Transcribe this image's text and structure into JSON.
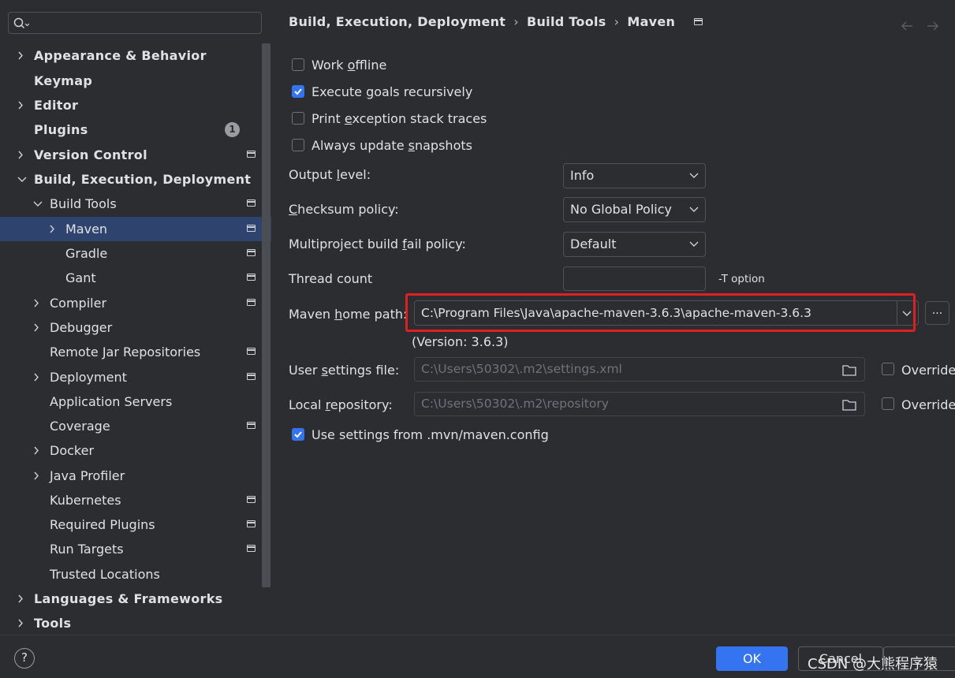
{
  "sidebar": {
    "search_placeholder": "",
    "items": [
      {
        "label": "Appearance & Behavior"
      },
      {
        "label": "Keymap"
      },
      {
        "label": "Editor"
      },
      {
        "label": "Plugins",
        "badge": "1"
      },
      {
        "label": "Version Control"
      },
      {
        "label": "Build, Execution, Deployment"
      },
      {
        "label": "Build Tools"
      },
      {
        "label": "Maven"
      },
      {
        "label": "Gradle"
      },
      {
        "label": "Gant"
      },
      {
        "label": "Compiler"
      },
      {
        "label": "Debugger"
      },
      {
        "label": "Remote Jar Repositories"
      },
      {
        "label": "Deployment"
      },
      {
        "label": "Application Servers"
      },
      {
        "label": "Coverage"
      },
      {
        "label": "Docker"
      },
      {
        "label": "Java Profiler"
      },
      {
        "label": "Kubernetes"
      },
      {
        "label": "Required Plugins"
      },
      {
        "label": "Run Targets"
      },
      {
        "label": "Trusted Locations"
      },
      {
        "label": "Languages & Frameworks"
      },
      {
        "label": "Tools"
      }
    ]
  },
  "breadcrumb": {
    "part1": "Build, Execution, Deployment",
    "part2": "Build Tools",
    "part3": "Maven",
    "sep": "›"
  },
  "options": {
    "work_offline": {
      "pre": "Work ",
      "u": "o",
      "post": "ffline",
      "checked": false
    },
    "execute_goals": {
      "pre": "Execute ",
      "u": "g",
      "post": "oals recursively",
      "checked": true
    },
    "print_exception": {
      "pre": "Print ",
      "u": "e",
      "post": "xception stack traces",
      "checked": false
    },
    "always_update": {
      "pre": "Always update ",
      "u": "s",
      "post": "napshots",
      "checked": false
    }
  },
  "output_level": {
    "pre": "Output ",
    "u": "l",
    "post": "evel:",
    "value": "Info"
  },
  "checksum_policy": {
    "pre": "",
    "u": "C",
    "post": "hecksum policy:",
    "value": "No Global Policy"
  },
  "multiproject": {
    "pre": "Multiproject build ",
    "u": "f",
    "post": "ail policy:",
    "value": "Default"
  },
  "thread_count": {
    "label": "Thread count",
    "value": "",
    "hint": "-T option"
  },
  "maven_home": {
    "pre": "Maven ",
    "u": "h",
    "post": "ome path:",
    "value": "C:\\Program Files\\Java\\apache-maven-3.6.3\\apache-maven-3.6.3",
    "browse": "...",
    "version": "(Version: 3.6.3)"
  },
  "user_settings": {
    "pre": "User ",
    "u": "s",
    "post": "ettings file:",
    "value": "C:\\Users\\50302\\.m2\\settings.xml",
    "override": "Override"
  },
  "local_repo": {
    "pre": "Local ",
    "u": "r",
    "post": "epository:",
    "value": "C:\\Users\\50302\\.m2\\repository",
    "override": "Override"
  },
  "use_mvn_config": {
    "label": "Use settings from .mvn/maven.config",
    "checked": true
  },
  "footer": {
    "help": "?",
    "ok": "OK",
    "cancel": "Cancel",
    "watermark": "CSDN @大熊程序猿"
  },
  "colors": {
    "accent": "#3574f0",
    "selection": "#2e436e",
    "highlight": "#e02020",
    "background": "#2b2d30"
  }
}
